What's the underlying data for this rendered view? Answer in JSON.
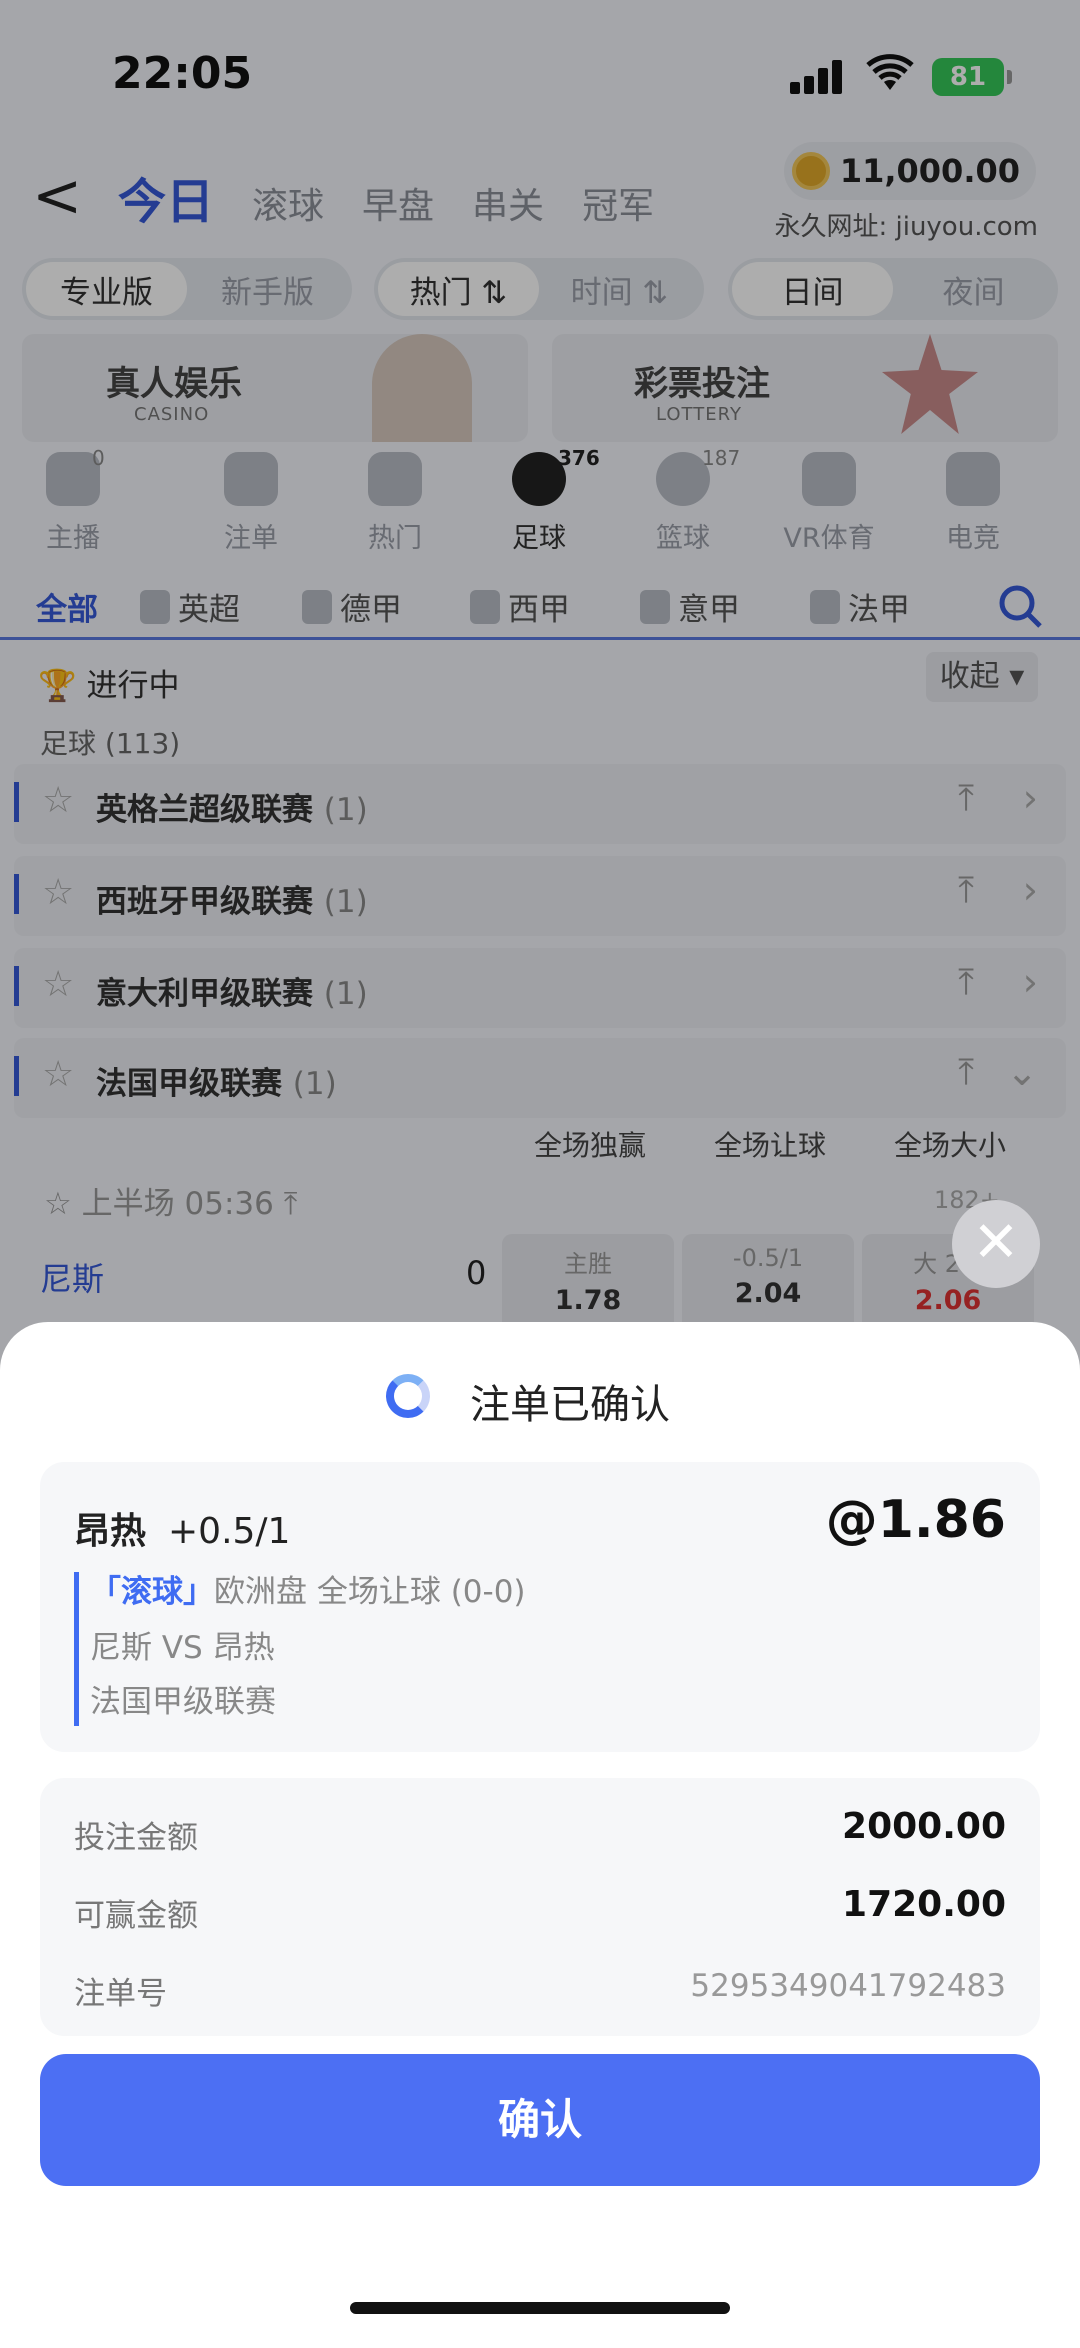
{
  "status": {
    "time": "22:05",
    "battery": "81"
  },
  "header": {
    "back": "<",
    "tabs": [
      "今日",
      "滚球",
      "早盘",
      "串关",
      "冠军"
    ],
    "balance": "11,000.00",
    "site": "永久网址: jiuyou.com"
  },
  "segments": {
    "mode": [
      "专业版",
      "新手版"
    ],
    "sort": [
      "热门 ⇅",
      "时间 ⇅"
    ],
    "theme": [
      "日间",
      "夜间"
    ]
  },
  "banners": [
    {
      "title": "真人娱乐",
      "sub": "CASINO"
    },
    {
      "title": "彩票投注",
      "sub": "LOTTERY"
    }
  ],
  "sports": [
    {
      "label": "主播",
      "count": "0"
    },
    {
      "label": "注单",
      "count": ""
    },
    {
      "label": "热门",
      "count": ""
    },
    {
      "label": "足球",
      "count": "376"
    },
    {
      "label": "篮球",
      "count": "187"
    },
    {
      "label": "VR体育",
      "count": ""
    },
    {
      "label": "电竞",
      "count": ""
    }
  ],
  "leagues": [
    "全部",
    "英超",
    "德甲",
    "西甲",
    "意甲",
    "法甲"
  ],
  "inplay": {
    "label": "进行中",
    "collapse": "收起 ▾"
  },
  "football_count": "足球 (113)",
  "league_rows": [
    {
      "name": "英格兰超级联赛",
      "count": "(1)"
    },
    {
      "name": "西班牙甲级联赛",
      "count": "(1)"
    },
    {
      "name": "意大利甲级联赛",
      "count": "(1)"
    },
    {
      "name": "法国甲级联赛",
      "count": "(1)"
    }
  ],
  "markets": [
    "全场独赢",
    "全场让球",
    "全场大小"
  ],
  "match": {
    "period": "上半场 05:36",
    "more": "182+",
    "home_team": "尼斯",
    "home_score": "0",
    "odds": [
      {
        "a": "主胜",
        "b": "1.78"
      },
      {
        "a": "-0.5/1",
        "b": "2.04"
      },
      {
        "a": "大 2.5",
        "b": "2.06"
      }
    ]
  },
  "sheet": {
    "title": "注单已确认",
    "pick_team": "昂热",
    "pick_line": "+0.5/1",
    "odds": "@1.86",
    "tag": "「滚球」",
    "market": "欧洲盘 全场让球 (0-0)",
    "matchup": "尼斯 VS 昂热",
    "league": "法国甲级联赛",
    "stake_label": "投注金额",
    "stake_value": "2000.00",
    "win_label": "可赢金额",
    "win_value": "1720.00",
    "order_label": "注单号",
    "order_value": "5295349041792483",
    "confirm": "确认"
  },
  "colors": {
    "accent": "#4c6ff3",
    "link": "#3559d8"
  }
}
